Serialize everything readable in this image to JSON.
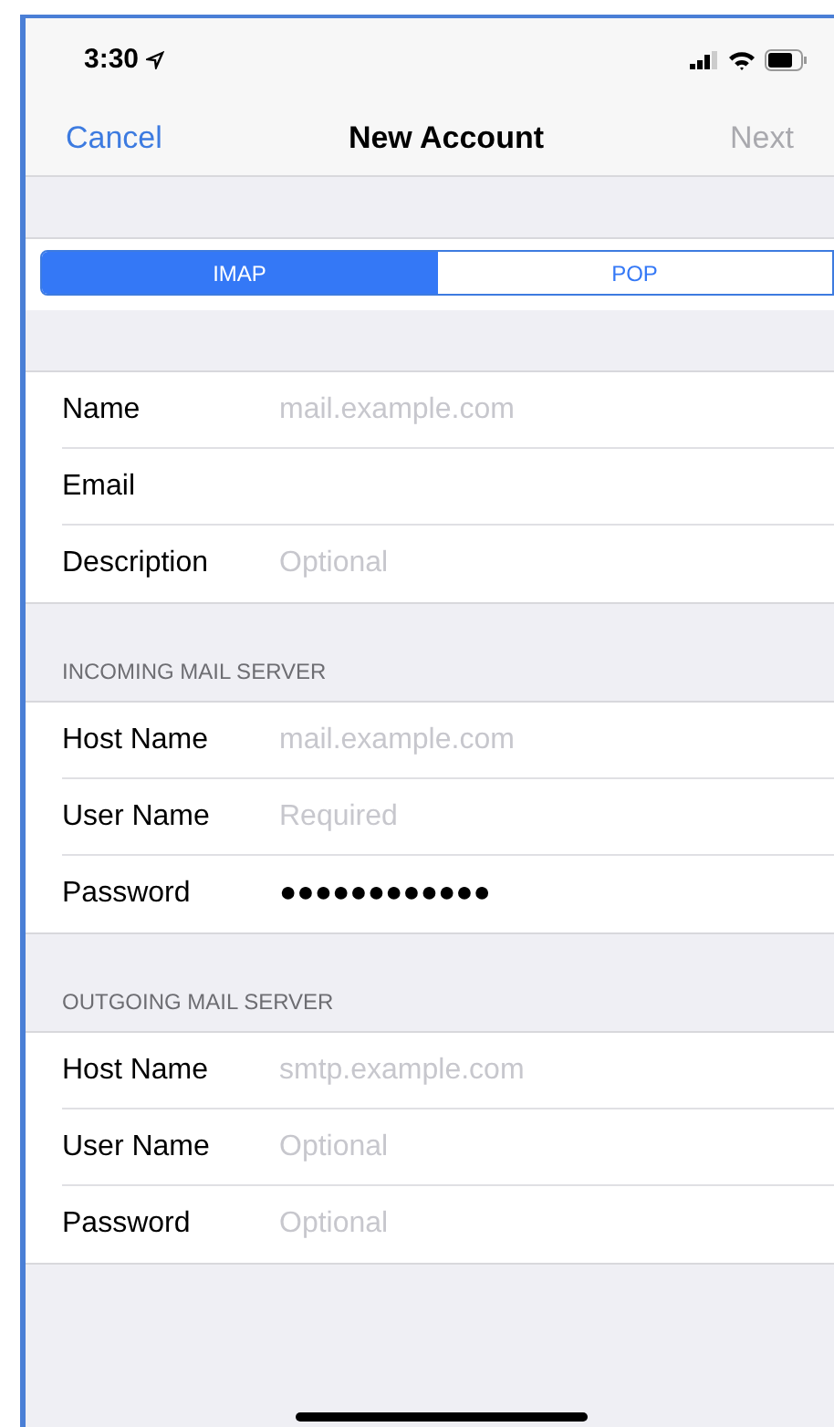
{
  "status_bar": {
    "time": "3:30"
  },
  "nav": {
    "cancel": "Cancel",
    "title": "New Account",
    "next": "Next",
    "next_disabled": true
  },
  "segments": [
    {
      "label": "IMAP",
      "selected": true
    },
    {
      "label": "POP",
      "selected": false
    }
  ],
  "sections": [
    {
      "fields": [
        {
          "label": "Name",
          "placeholder": "mail.example.com"
        },
        {
          "label": "Email"
        },
        {
          "label": "Description",
          "placeholder": "Optional"
        }
      ]
    },
    {
      "header": "INCOMING MAIL SERVER",
      "fields": [
        {
          "label": "Host Name",
          "placeholder": "mail.example.com"
        },
        {
          "label": "User Name",
          "placeholder": "Required"
        },
        {
          "label": "Password",
          "value": "●●●●●●●●●●●●"
        }
      ]
    },
    {
      "header": "OUTGOING MAIL SERVER",
      "fields": [
        {
          "label": "Host Name",
          "placeholder": "smtp.example.com"
        },
        {
          "label": "User Name",
          "placeholder": "Optional"
        },
        {
          "label": "Password",
          "placeholder": "Optional"
        }
      ]
    }
  ]
}
